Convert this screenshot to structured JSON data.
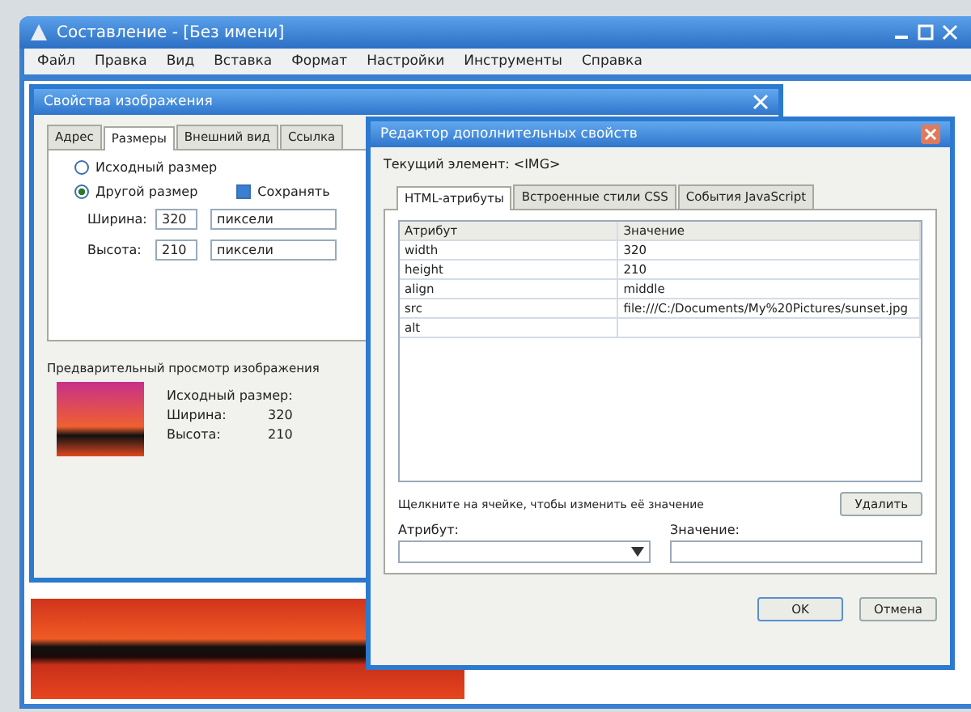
{
  "window": {
    "title": "Составление - [Без имени]"
  },
  "menu": [
    "Файл",
    "Правка",
    "Вид",
    "Вставка",
    "Формат",
    "Настройки",
    "Инструменты",
    "Справка"
  ],
  "image_dialog": {
    "title": "Свойства изображения",
    "tabs": [
      {
        "label": "Адрес",
        "selected": false
      },
      {
        "label": "Размеры",
        "selected": true
      },
      {
        "label": "Внешний вид",
        "selected": false
      },
      {
        "label": "Ссылка",
        "selected": false
      }
    ],
    "size_options": [
      {
        "label": "Исходный размер",
        "selected": false
      },
      {
        "label": "Другой размер",
        "selected": true
      }
    ],
    "keep_ratio": {
      "label": "Сохранять",
      "checked": true
    },
    "fields": [
      {
        "label": "Ширина:",
        "value": "320",
        "unit": "пиксели"
      },
      {
        "label": "Высота:",
        "value": "210",
        "unit": "пиксели"
      }
    ],
    "preview": {
      "title": "Предварительный просмотр изображения",
      "caption": "Исходный размер:",
      "lines": [
        {
          "label": "Ширина:",
          "value": "320"
        },
        {
          "label": "Высота:",
          "value": "210"
        }
      ]
    }
  },
  "attr_dialog": {
    "title": "Редактор дополнительных свойств",
    "current": "Текущий элемент: <IMG>",
    "tabs": [
      {
        "label": "HTML-атрибуты",
        "selected": true
      },
      {
        "label": "Встроенные стили CSS",
        "selected": false
      },
      {
        "label": "События JavaScript",
        "selected": false
      }
    ],
    "columns": [
      "Атрибут",
      "Значение"
    ],
    "rows": [
      {
        "name": "width",
        "value": "320"
      },
      {
        "name": "height",
        "value": "210"
      },
      {
        "name": "align",
        "value": "middle"
      },
      {
        "name": "src",
        "value": "file:///C:/Documents/My%20Pictures/sunset.jpg"
      },
      {
        "name": "alt"
      }
    ],
    "hint": "Щелкните на ячейке, чтобы изменить её значение",
    "delete_button": "Удалить",
    "attribute_label": "Атрибут:",
    "value_label": "Значение:",
    "buttons": [
      "OK",
      "Отмена"
    ]
  }
}
